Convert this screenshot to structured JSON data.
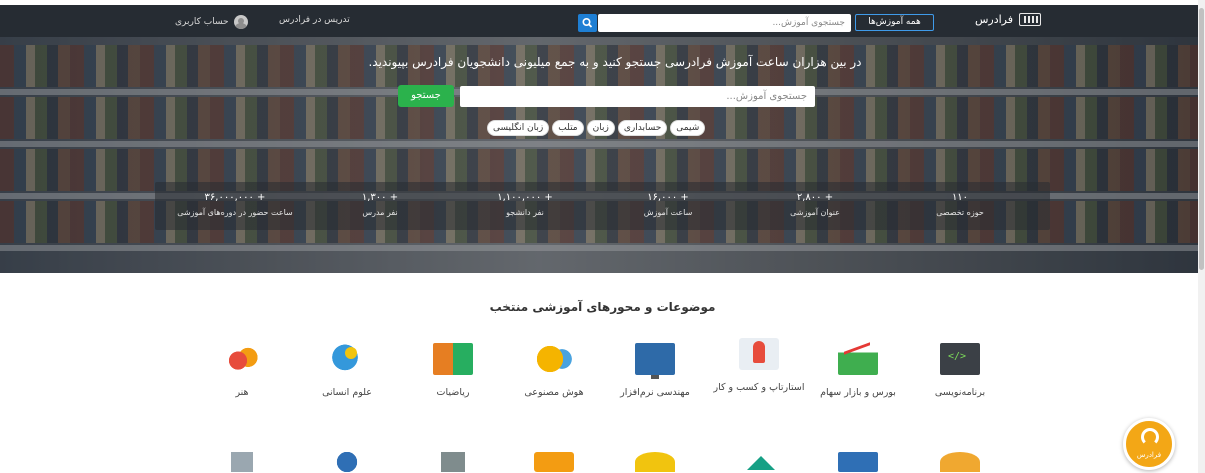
{
  "nav": {
    "brand": "فرادرس",
    "all_courses": "همه آموزش‌ها",
    "search_placeholder": "جستجوی آموزش...",
    "account": "حساب کاربری",
    "teach": "تدریس در فرادرس"
  },
  "hero": {
    "headline": "در بین هزاران ساعت آموزش فرادرسی جستجو کنید و به جمع میلیونی دانشجویان فرادرس بپیوندید.",
    "search_placeholder": "جستجوی آموزش...",
    "search_button": "جستجو",
    "tags": [
      "شیمی",
      "حسابداری",
      "زبان",
      "متلب",
      "زبان انگلیسی"
    ],
    "stats": [
      {
        "value": "۱۱۰",
        "label": "حوزه تخصصی"
      },
      {
        "value": "+ ۲,۸۰۰",
        "label": "عنوان آموزشی"
      },
      {
        "value": "+ ۱۶,۰۰۰",
        "label": "ساعت آموزش"
      },
      {
        "value": "+ ۱,۱۰۰,۰۰۰",
        "label": "نفر دانشجو"
      },
      {
        "value": "+ ۱,۳۰۰",
        "label": "نفر مدرس"
      },
      {
        "value": "+ ۳۶,۰۰۰,۰۰۰",
        "label": "ساعت حضور در دوره‌های آموزشی"
      }
    ]
  },
  "topics": {
    "title": "موضوعات و محورهای آموزشی منتخب",
    "items": [
      {
        "label": "برنامه‌نویسی",
        "icon": "code-icon"
      },
      {
        "label": "بورس و بازار سهام",
        "icon": "stock-chart-icon"
      },
      {
        "label": "استارتاپ و کسب و کار",
        "icon": "rocket-icon"
      },
      {
        "label": "مهندسی نرم‌افزار",
        "icon": "monitor-icon"
      },
      {
        "label": "هوش مصنوعی",
        "icon": "brain-icon"
      },
      {
        "label": "ریاضیات",
        "icon": "calculator-icon"
      },
      {
        "label": "علوم انسانی",
        "icon": "head-idea-icon"
      },
      {
        "label": "هنر",
        "icon": "art-masks-icon"
      }
    ]
  },
  "help": {
    "label": "فرادرس"
  },
  "colors": {
    "nav_bg": "#262c33",
    "search_btn": "#1e7fd4",
    "hero_btn": "#2bb24c",
    "help_bg": "#f3a716"
  }
}
